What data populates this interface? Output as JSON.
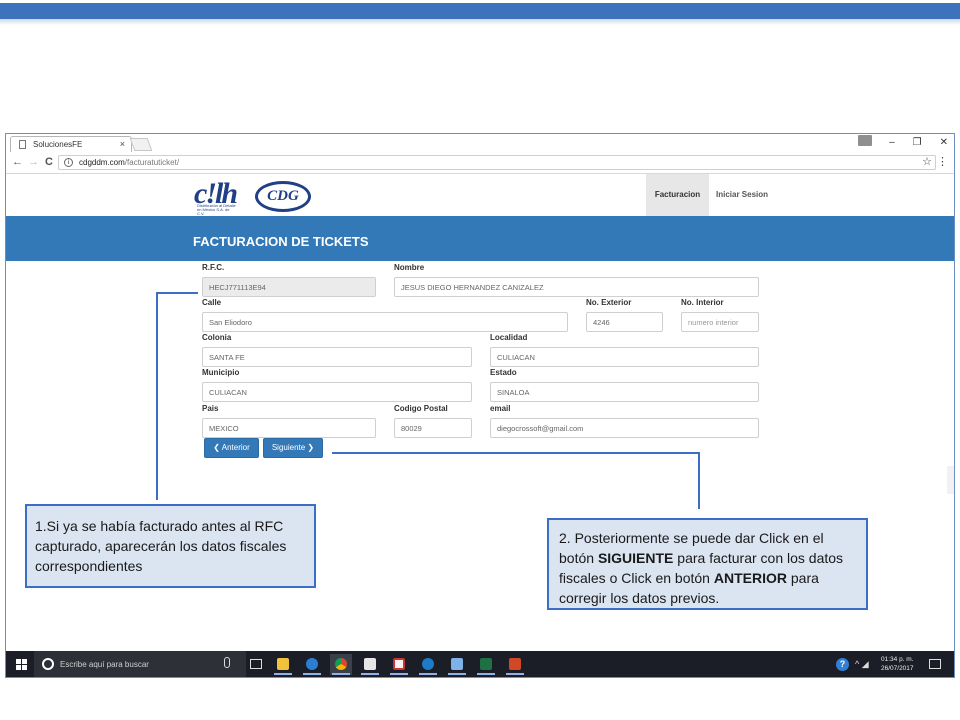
{
  "browser": {
    "tab_title": "SolucionesFE",
    "tab_close": "×",
    "url_host": "cdgddm.com",
    "url_path": "/facturatuticket/",
    "back": "←",
    "forward": "→",
    "reload": "C",
    "star": "☆",
    "menu": "⋮",
    "info": "i",
    "minimize": "–",
    "restore": "❐",
    "close": "✕"
  },
  "site": {
    "logo_text": "CDG",
    "logo_mark": "c!lh",
    "logo_subtitle": "Distribución al Detalle en México S.A. de C.V.",
    "nav": {
      "facturacion": "Facturacion",
      "login": "Iniciar Sesion"
    },
    "banner_title": "FACTURACION DE TICKETS"
  },
  "form": {
    "rfc": {
      "label": "R.F.C.",
      "value": "HECJ771113E94"
    },
    "nombre": {
      "label": "Nombre",
      "value": "JESUS DIEGO HERNANDEZ CANIZALEZ"
    },
    "calle": {
      "label": "Calle",
      "value": "San Eliodoro"
    },
    "no_ext": {
      "label": "No. Exterior",
      "value": "4246"
    },
    "no_int": {
      "label": "No. Interior",
      "placeholder": "numero interior"
    },
    "colonia": {
      "label": "Colonia",
      "value": "SANTA FE"
    },
    "localidad": {
      "label": "Localidad",
      "value": "CULIACAN"
    },
    "municipio": {
      "label": "Municipio",
      "value": "CULIACAN"
    },
    "estado": {
      "label": "Estado",
      "value": "SINALOA"
    },
    "pais": {
      "label": "Pais",
      "value": "MEXICO"
    },
    "cp": {
      "label": "Codigo Postal",
      "value": "80029"
    },
    "email": {
      "label": "email",
      "value": "diegocrossoft@gmail.com"
    },
    "btn_anterior": "❮ Anterior",
    "btn_siguiente": "Siguiente ❯"
  },
  "taskbar": {
    "search_placeholder": "Escribe aquí para buscar",
    "time": "01:34 p. m.",
    "date": "26/07/2017",
    "help": "?",
    "tray": "^ ◢"
  },
  "callouts": {
    "left": "1.Si ya se había facturado antes al RFC capturado, aparecerán los datos fiscales correspondientes",
    "right_p1": "2. Posteriormente  se puede dar Click en el botón ",
    "right_b1": "SIGUIENTE",
    "right_p2": " para facturar con  los datos fiscales o Click en botón ",
    "right_b2": "ANTERIOR",
    "right_p3": " para corregir los datos previos."
  },
  "colors": {
    "primary": "#3479b7",
    "callout_bg": "#dbe4f1",
    "callout_border": "#3c6ec4",
    "taskbar": "#1b1e26"
  }
}
